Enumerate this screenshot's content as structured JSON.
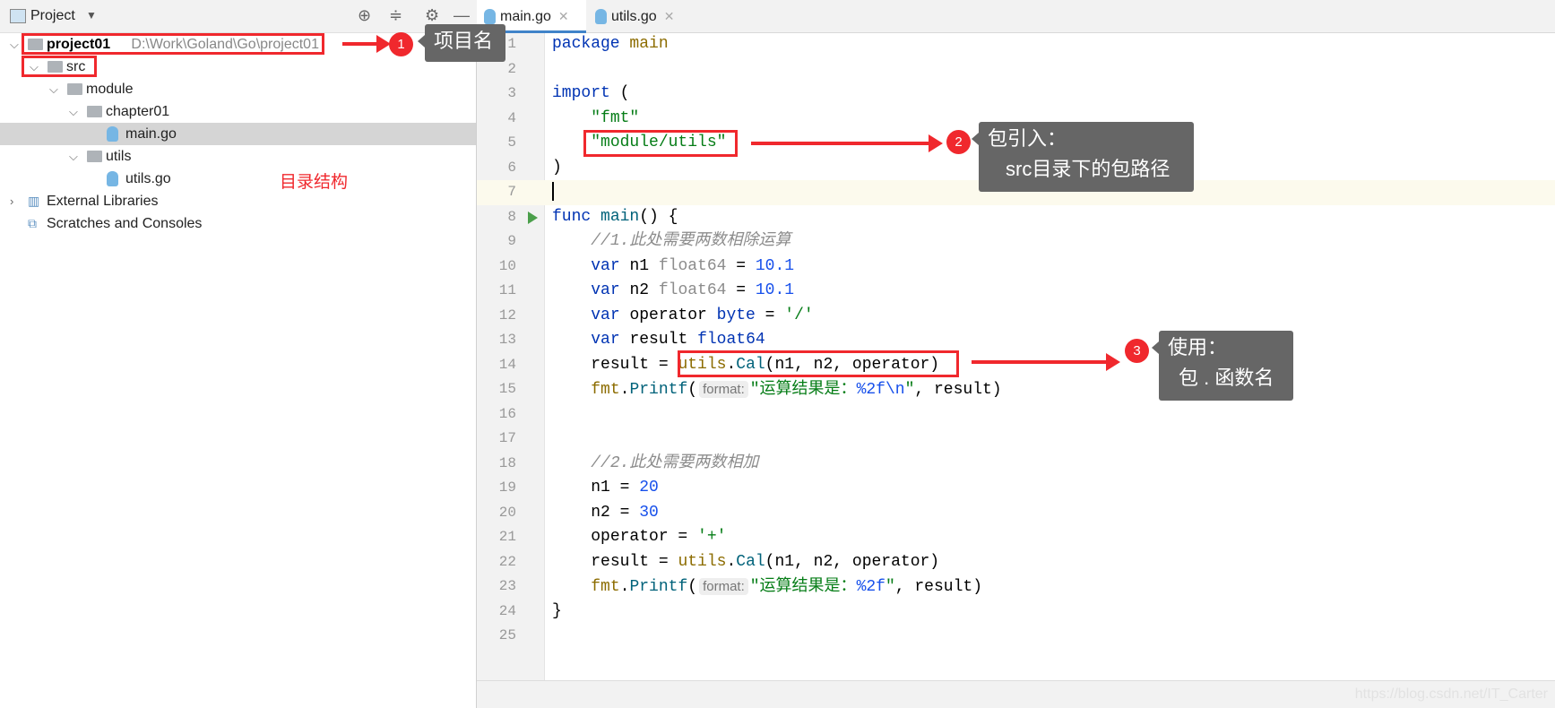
{
  "sidebar": {
    "title": "Project",
    "tree": [
      {
        "label": "project01",
        "path": "D:\\Work\\Goland\\Go\\project01",
        "icon": "folder",
        "level": 0,
        "expanded": true,
        "bold": true
      },
      {
        "label": "src",
        "icon": "folder",
        "level": 1,
        "expanded": true
      },
      {
        "label": "module",
        "icon": "folder",
        "level": 2,
        "expanded": true
      },
      {
        "label": "chapter01",
        "icon": "folder",
        "level": 3,
        "expanded": true
      },
      {
        "label": "main.go",
        "icon": "go-file",
        "level": 4,
        "selected": true
      },
      {
        "label": "utils",
        "icon": "folder",
        "level": 3,
        "expanded": true
      },
      {
        "label": "utils.go",
        "icon": "go-file",
        "level": 4
      },
      {
        "label": "External Libraries",
        "icon": "library",
        "level": 0,
        "expanded": false
      },
      {
        "label": "Scratches and Consoles",
        "icon": "scratches",
        "level": 0
      }
    ]
  },
  "tabs": [
    {
      "label": "main.go",
      "active": true
    },
    {
      "label": "utils.go",
      "active": false
    }
  ],
  "editor": {
    "current_line": 7,
    "lines": [
      [
        [
          "package ",
          "k"
        ],
        [
          "main",
          "o"
        ]
      ],
      [],
      [
        [
          "import",
          "k"
        ],
        [
          " (",
          "d"
        ]
      ],
      [
        [
          "    ",
          "d"
        ],
        [
          "\"fmt\"",
          "s"
        ]
      ],
      [
        [
          "    ",
          "d"
        ],
        [
          "\"module/utils\"",
          "s"
        ]
      ],
      [
        [
          ")",
          "d"
        ]
      ],
      [
        [
          "|",
          "caret"
        ]
      ],
      [
        [
          "func ",
          "k"
        ],
        [
          "main",
          "f"
        ],
        [
          "() {",
          "d"
        ]
      ],
      [
        [
          "    ",
          "d"
        ],
        [
          "//1.此处需要两数相除运算",
          "c"
        ]
      ],
      [
        [
          "    ",
          "d"
        ],
        [
          "var ",
          "k"
        ],
        [
          "n1 ",
          "d"
        ],
        [
          "float64",
          "g"
        ],
        [
          " = ",
          "d"
        ],
        [
          "10.1",
          "n"
        ]
      ],
      [
        [
          "    ",
          "d"
        ],
        [
          "var ",
          "k"
        ],
        [
          "n2 ",
          "d"
        ],
        [
          "float64",
          "g"
        ],
        [
          " = ",
          "d"
        ],
        [
          "10.1",
          "n"
        ]
      ],
      [
        [
          "    ",
          "d"
        ],
        [
          "var ",
          "k"
        ],
        [
          "operator ",
          "d"
        ],
        [
          "byte",
          "k"
        ],
        [
          " = ",
          "d"
        ],
        [
          "'/'",
          "s"
        ]
      ],
      [
        [
          "    ",
          "d"
        ],
        [
          "var ",
          "k"
        ],
        [
          "result ",
          "d"
        ],
        [
          "float64",
          "k"
        ]
      ],
      [
        [
          "    ",
          "d"
        ],
        [
          "result = ",
          "d"
        ],
        [
          "utils",
          "o"
        ],
        [
          ".",
          "d"
        ],
        [
          "Cal",
          "f"
        ],
        [
          "(n1, n2, operator)",
          "d"
        ]
      ],
      [
        [
          "    ",
          "d"
        ],
        [
          "fmt",
          "o"
        ],
        [
          ".",
          "d"
        ],
        [
          "Printf",
          "f"
        ],
        [
          "(",
          "d"
        ],
        [
          "format:",
          "hint"
        ],
        [
          "\"运算结果是：",
          "s"
        ],
        [
          "%2f\\n",
          "n"
        ],
        [
          "\"",
          "s"
        ],
        [
          ", result)",
          "d"
        ]
      ],
      [],
      [],
      [
        [
          "    ",
          "d"
        ],
        [
          "//2.此处需要两数相加",
          "c"
        ]
      ],
      [
        [
          "    ",
          "d"
        ],
        [
          "n1 = ",
          "d"
        ],
        [
          "20",
          "n"
        ]
      ],
      [
        [
          "    ",
          "d"
        ],
        [
          "n2 = ",
          "d"
        ],
        [
          "30",
          "n"
        ]
      ],
      [
        [
          "    ",
          "d"
        ],
        [
          "operator = ",
          "d"
        ],
        [
          "'+'",
          "s"
        ]
      ],
      [
        [
          "    ",
          "d"
        ],
        [
          "result = ",
          "d"
        ],
        [
          "utils",
          "o"
        ],
        [
          ".",
          "d"
        ],
        [
          "Cal",
          "f"
        ],
        [
          "(n1, n2, operator)",
          "d"
        ]
      ],
      [
        [
          "    ",
          "d"
        ],
        [
          "fmt",
          "o"
        ],
        [
          ".",
          "d"
        ],
        [
          "Printf",
          "f"
        ],
        [
          "(",
          "d"
        ],
        [
          "format:",
          "hint"
        ],
        [
          "\"运算结果是：",
          "s"
        ],
        [
          "%2f",
          "n"
        ],
        [
          "\"",
          "s"
        ],
        [
          ", result)",
          "d"
        ]
      ],
      [
        [
          "}",
          "d"
        ]
      ],
      []
    ]
  },
  "annotations": {
    "a1": {
      "num": "1",
      "text": "项目名"
    },
    "a2": {
      "num": "2",
      "line1": "包引入：",
      "line2": "src目录下的包路径"
    },
    "a3": {
      "num": "3",
      "line1": "使用：",
      "line2": "包 . 函数名"
    },
    "dir_note": "目录结构",
    "color": "#f0282d"
  },
  "watermark": "https://blog.csdn.net/IT_Carter"
}
